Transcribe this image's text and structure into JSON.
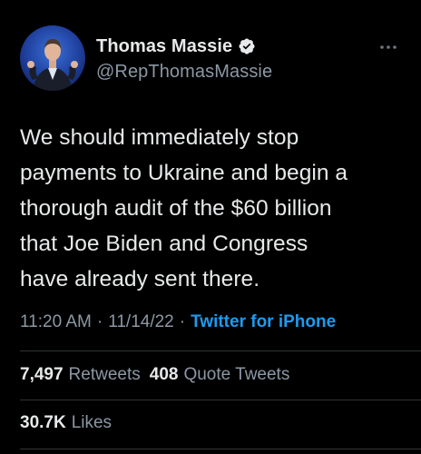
{
  "user": {
    "display_name": "Thomas Massie",
    "handle": "@RepThomasMassie"
  },
  "icons": {
    "verified": "verified-badge-icon",
    "more": "more-horizontal-icon"
  },
  "tweet": {
    "text_lines": [
      "We should immediately stop",
      "payments to Ukraine and begin a",
      "thorough audit of the $60 billion",
      "that Joe Biden and Congress",
      "have already sent there."
    ],
    "time": "11:20 AM",
    "date": "11/14/22",
    "separator": "·",
    "source": "Twitter for iPhone"
  },
  "stats": {
    "retweets_count": "7,497",
    "retweets_label": "Retweets",
    "quotes_count": "408",
    "quotes_label": "Quote Tweets",
    "likes_count": "30.7K",
    "likes_label": "Likes"
  },
  "colors": {
    "background": "#000000",
    "text_primary": "#e7e9ea",
    "text_secondary": "#8b98a5",
    "accent": "#1d9bf0",
    "divider": "#2f3336"
  }
}
